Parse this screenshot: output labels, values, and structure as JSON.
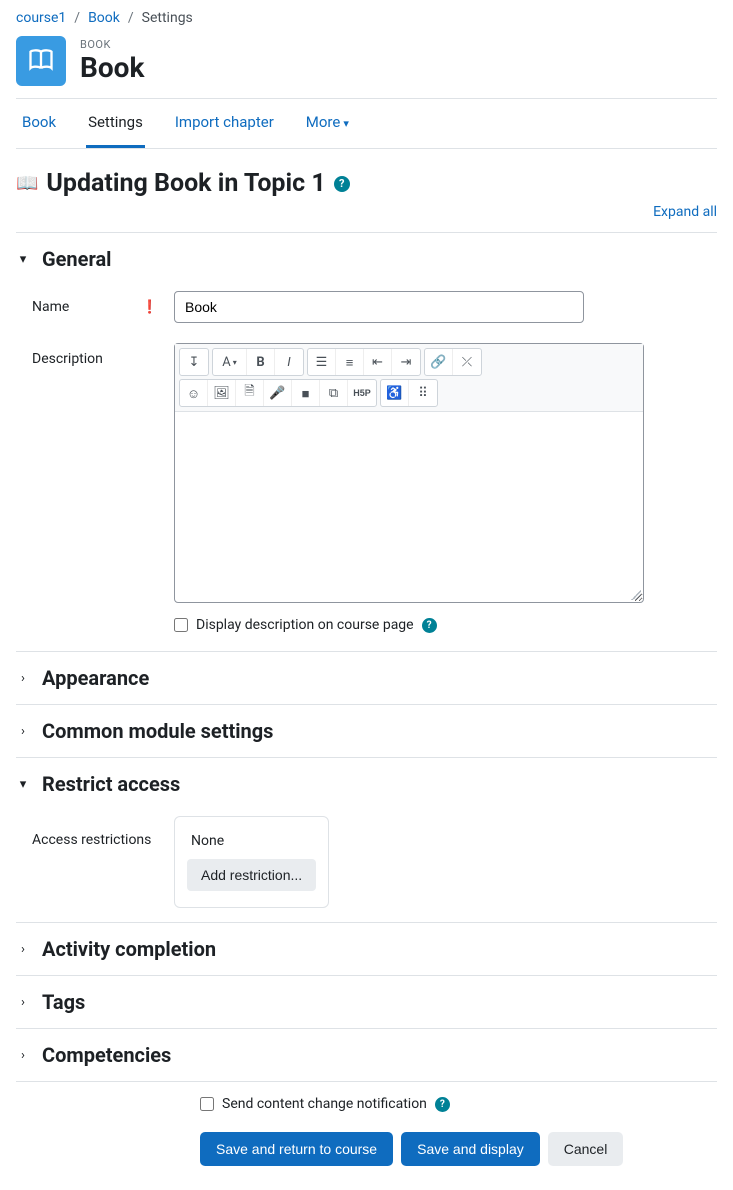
{
  "breadcrumb": {
    "course": "course1",
    "book": "Book",
    "current": "Settings"
  },
  "header": {
    "kicker": "BOOK",
    "title": "Book"
  },
  "tabs": {
    "book": "Book",
    "settings": "Settings",
    "import": "Import chapter",
    "more": "More"
  },
  "page": {
    "heading": "Updating Book in Topic 1",
    "expand_all": "Expand all"
  },
  "general": {
    "title": "General",
    "name_label": "Name",
    "name_value": "Book",
    "desc_label": "Description",
    "display_desc": "Display description on course page"
  },
  "sections": {
    "appearance": "Appearance",
    "common": "Common module settings",
    "restrict": "Restrict access",
    "activity": "Activity completion",
    "tags": "Tags",
    "competencies": "Competencies"
  },
  "restrict": {
    "label": "Access restrictions",
    "none": "None",
    "add": "Add restriction..."
  },
  "notify": "Send content change notification",
  "actions": {
    "save_return": "Save and return to course",
    "save_display": "Save and display",
    "cancel": "Cancel"
  }
}
